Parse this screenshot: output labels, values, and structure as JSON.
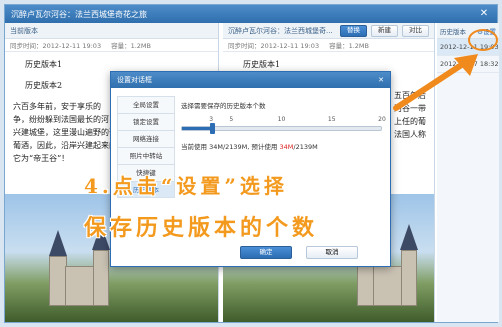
{
  "window": {
    "title": "沉醉卢瓦尔河谷：法兰西城堡奇花之旅",
    "close_glyph": "✕"
  },
  "left": {
    "header": "当前版本",
    "meta": {
      "time": "同步时间：2012-12-11 19:03",
      "size": "容量：1.2MB"
    },
    "doc": {
      "h1": "历史版本1",
      "h2": "历史版本2",
      "p1": "六百多年前，安于享乐的",
      "p2": "争，纷纷躲到法国最长的河",
      "p3": "兴建城堡，这里漫山遍野的葡",
      "p4": "葡酒，因此，沿岸兴建起来的",
      "p5": "它为“帝王谷”！"
    }
  },
  "mid": {
    "header": "沉醉卢瓦尔河谷：法兰西城堡奇...",
    "buttons": {
      "replace": "替换",
      "new": "新建",
      "compare": "对比"
    },
    "meta": {
      "time": "同步时间：2012-12-11 19:03",
      "size": "容量：1.2MB"
    },
    "doc": {
      "h1": "历史版本1",
      "r1": "五百年后",
      "r2": "河谷一带",
      "r3": "上任的葡",
      "r4": "法国人称"
    }
  },
  "history": {
    "label": "历史版本",
    "settings": "设置",
    "items": [
      "2012-12-11 19:03",
      "2012-12-07 18:32"
    ]
  },
  "dialog": {
    "title": "设置对话框",
    "close_glyph": "✕",
    "nav": [
      "全局设置",
      "锁定设置",
      "网络连接",
      "照片中转站",
      "快捷键",
      "历史版本"
    ],
    "selected_nav": 5,
    "label": "选择需要保存的历史版本个数",
    "scale": [
      "3",
      "5",
      "10",
      "15",
      "20"
    ],
    "value": 3,
    "min": 3,
    "max": 20,
    "usage_prefix": "当前使用 34M/2139M, 预计使用 ",
    "usage_red": "34M",
    "usage_suffix": "/2139M",
    "ok": "确定",
    "cancel": "取消"
  },
  "caption": {
    "line1": "4.点击“设置”选择",
    "line2": "保存历史版本的个数"
  },
  "colors": {
    "accent": "#2c6db3",
    "highlight": "#f39a1e",
    "warning": "#dd2222"
  }
}
